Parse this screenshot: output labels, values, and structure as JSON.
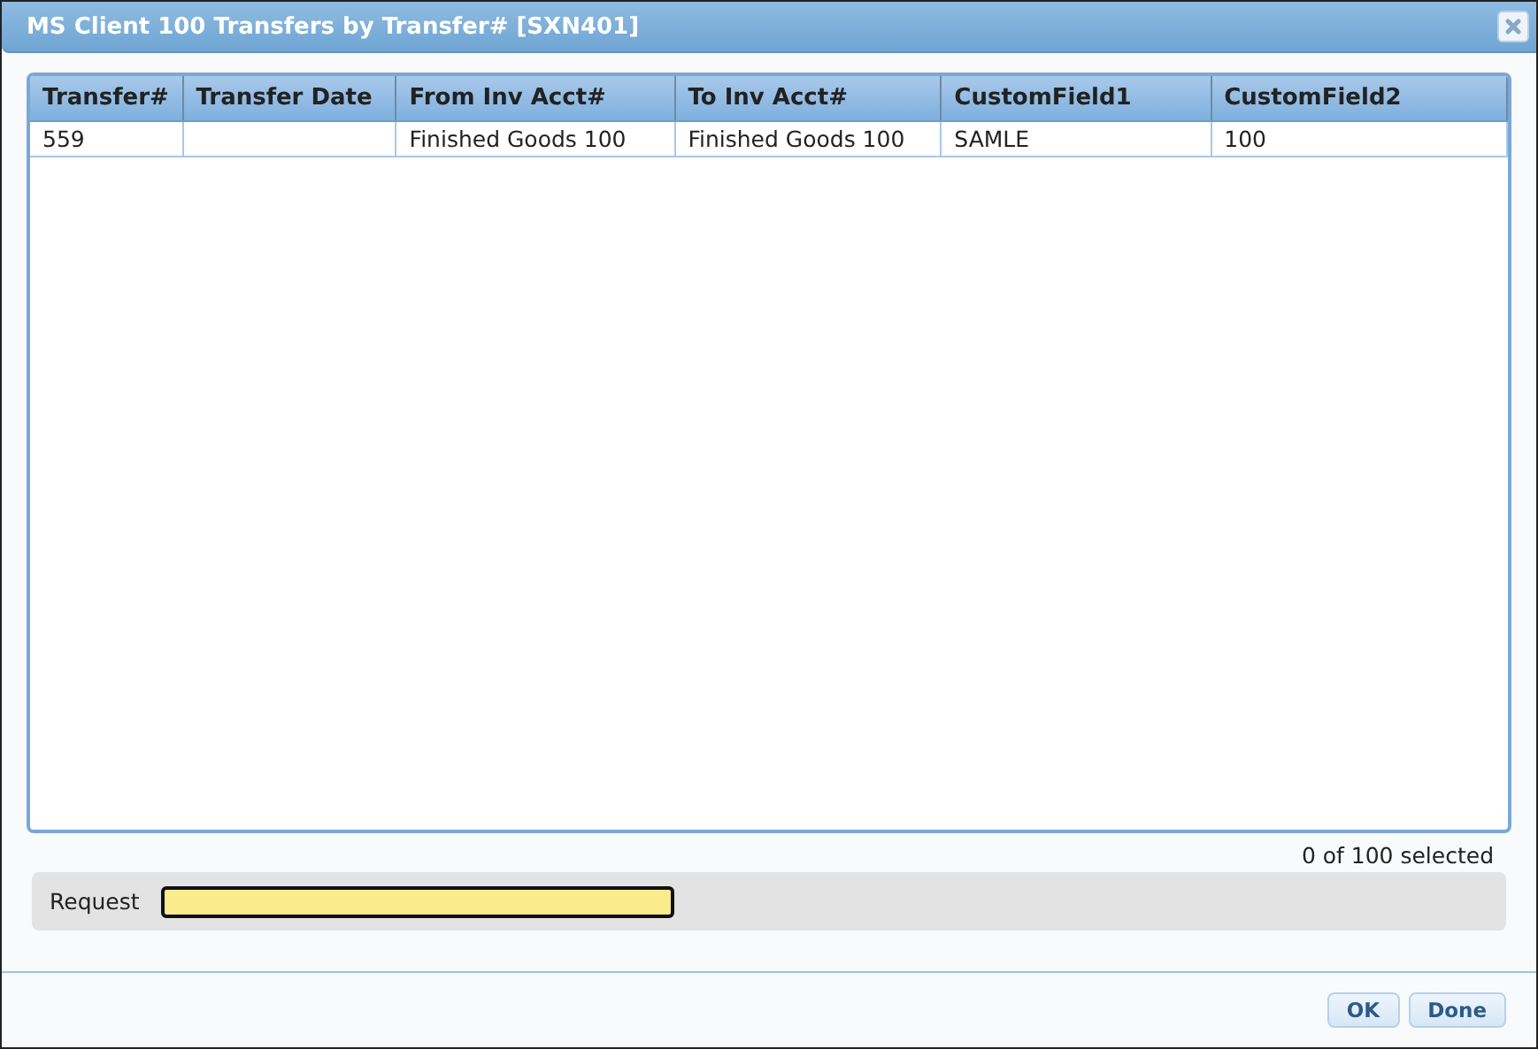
{
  "window": {
    "title": "MS Client 100 Transfers by Transfer# [SXN401]"
  },
  "table": {
    "columns": [
      "Transfer#",
      "Transfer Date",
      "From Inv Acct#",
      "To Inv Acct#",
      "CustomField1",
      "CustomField2"
    ],
    "rows": [
      {
        "cells": [
          "559",
          null,
          "Finished Goods 100",
          "Finished Goods 100",
          "SAMLE",
          "100"
        ],
        "selected": false
      }
    ]
  },
  "selection_count": "0 of 100 selected",
  "request": {
    "label": "Request"
  },
  "buttons": [
    "OK",
    "Done"
  ]
}
